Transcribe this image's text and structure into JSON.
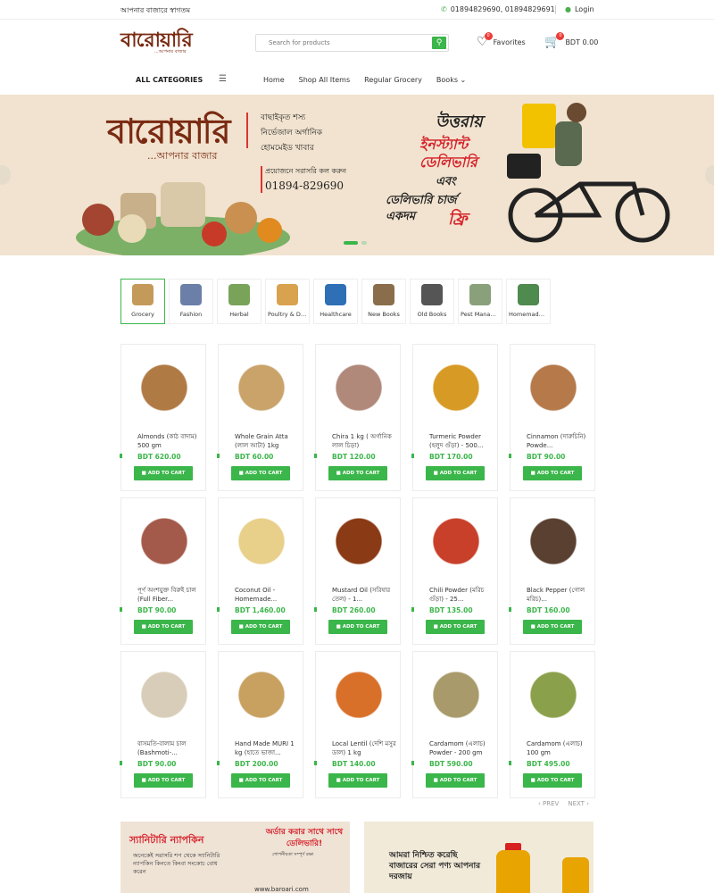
{
  "topbar": {
    "tagline": "আপনার বাজারে স্বাগতম",
    "phones": "01894829690, 01894829691",
    "login": "Login"
  },
  "header": {
    "logo_text": "বারোয়ারি",
    "logo_sub": "...আপনার বাজার",
    "search_placeholder": "Search for products",
    "favorites_label": "Favorites",
    "favorites_count": "0",
    "cart_count": "0",
    "cart_total": "BDT 0.00"
  },
  "nav": {
    "all_categories": "ALL CATEGORIES",
    "items": [
      "Home",
      "Shop All Items",
      "Regular Grocery",
      "Books"
    ]
  },
  "banner": {
    "logo": "বারোয়ারি",
    "tagline": "...আপনার বাজার",
    "features": [
      "বাছাইকৃত শস্য",
      "নির্ভেজাল অর্গানিক",
      "হোমমেইড খাবার"
    ],
    "call_note": "প্রয়োজনে সরাসরি কল করুন",
    "phone": "01894-829690",
    "headline_1": "উত্তরায়",
    "headline_2a": "ইনস্ট্যান্ট",
    "headline_2b": "ডেলিভারি",
    "headline_3": "এবং",
    "headline_4a": "ডেলিভারি চার্জ",
    "headline_4b": "একদম",
    "headline_5": "ফ্রি"
  },
  "categories": [
    {
      "label": "Grocery",
      "color": "#c49a5b"
    },
    {
      "label": "Fashion",
      "color": "#6b7fa8"
    },
    {
      "label": "Herbal",
      "color": "#7aa35a"
    },
    {
      "label": "Poultry & Dairy",
      "color": "#d9a24f"
    },
    {
      "label": "Healthcare",
      "color": "#2f6fb5"
    },
    {
      "label": "New Books",
      "color": "#8a6e4b"
    },
    {
      "label": "Old Books",
      "color": "#555555"
    },
    {
      "label": "Pest Manage...",
      "color": "#8aa07a"
    },
    {
      "label": "Homemade F...",
      "color": "#4f8a4f"
    }
  ],
  "products": [
    {
      "name": "Almonds (কাঠ বাদাম) 500 gm",
      "price": "BDT 620.00",
      "color": "#b07a45"
    },
    {
      "name": "Whole Grain Atta (লাল আটা) 1kg",
      "price": "BDT 60.00",
      "color": "#c9a36a"
    },
    {
      "name": "Chira 1 kg ( অর্গানিক লাল চিড়া)",
      "price": "BDT 120.00",
      "color": "#b0897a"
    },
    {
      "name": "Turmeric Powder (হলুদ গুঁড়া) - 500...",
      "price": "BDT 170.00",
      "color": "#d79a24"
    },
    {
      "name": "Cinnamon (দারুচিনি) Powde...",
      "price": "BDT 90.00",
      "color": "#b5794a"
    },
    {
      "name": "পূর্ণ অংশযুক্ত বিরুই চাল (Full Fiber...",
      "price": "BDT 90.00",
      "color": "#a45a4a"
    },
    {
      "name": "Coconut Oil - Homemade...",
      "price": "BDT 1,460.00",
      "color": "#e8cf8a"
    },
    {
      "name": "Mustard Oil (সরিষার তেল) - 1...",
      "price": "BDT 260.00",
      "color": "#8a3a14"
    },
    {
      "name": "Chili Powder (মরিচ গুঁড়া) - 25...",
      "price": "BDT 135.00",
      "color": "#c8402a"
    },
    {
      "name": "Black Pepper (গোল মরিচ)...",
      "price": "BDT 160.00",
      "color": "#5a4030"
    },
    {
      "name": "বাসমতি-বালাম চাল (Bashmoti-...",
      "price": "BDT 90.00",
      "color": "#d8cdb8"
    },
    {
      "name": "Hand Made MURI 1 kg (হাতে ভাজা...",
      "price": "BDT 200.00",
      "color": "#c8a060"
    },
    {
      "name": "Local Lentil (দেশি মসুর ডাল) 1 kg",
      "price": "BDT 140.00",
      "color": "#d8702a"
    },
    {
      "name": "Cardamom (এলাচ) Powder - 200 gm",
      "price": "BDT 590.00",
      "color": "#a89a6a"
    },
    {
      "name": "Cardamom (এলাচ) 100 gm",
      "price": "BDT 495.00",
      "color": "#8aa04a"
    }
  ],
  "add_to_cart_label": "ADD TO CART",
  "pager": {
    "prev": "PREV",
    "next": "NEXT"
  },
  "promo_left": {
    "title": "স্যানিটারি ন্যাপকিন",
    "text": "অনেকেই সরাসরি শপ থেকে স্যানিটারি ন্যাপকিন কিনতে কিংবা সংকোচ বোধ করেন",
    "title2": "অর্ডার করার সাথে সাথে ডেলিভারি!",
    "note": "গোপনীয়তা সম্পূর্ণ রক্ষা",
    "url": "www.baroari.com"
  },
  "promo_right": {
    "text": "আমরা নিশ্চিত করেছি বাজারের সেরা পণ্য আপনার দরজায়"
  }
}
